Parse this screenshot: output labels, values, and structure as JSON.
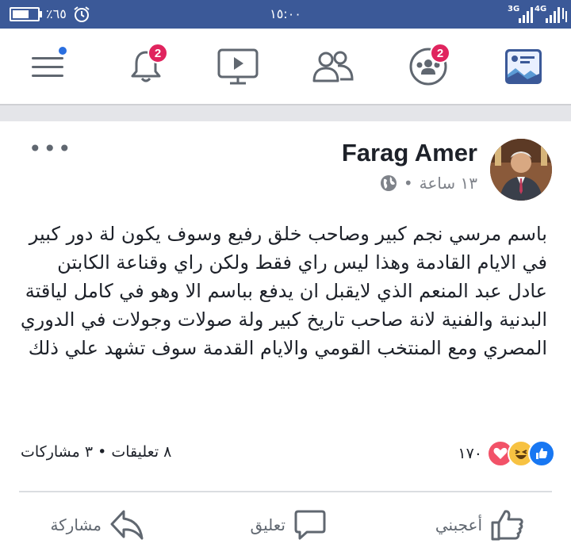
{
  "status_bar": {
    "battery_percent_text": "٪٦٥",
    "battery_level": 0.65,
    "time": "١٥:٠٠",
    "network_3g": "3G",
    "network_4g": "4G",
    "bg_color": "#3b5998"
  },
  "nav": {
    "items": [
      {
        "name": "menu",
        "icon": "hamburger-menu-icon",
        "has_dot": true
      },
      {
        "name": "notifications",
        "icon": "bell-icon",
        "badge": "2"
      },
      {
        "name": "watch",
        "icon": "video-play-icon"
      },
      {
        "name": "friends",
        "icon": "friends-icon"
      },
      {
        "name": "groups",
        "icon": "groups-icon",
        "badge": "2"
      },
      {
        "name": "news-feed",
        "icon": "news-feed-icon",
        "active": true
      }
    ],
    "accent_color": "#3b5998",
    "badge_color": "#e0245e"
  },
  "post": {
    "author": "Farag Amer",
    "time": "١٣ ساعة",
    "privacy_icon": "globe-icon",
    "more_label": "•••",
    "text": "باسم مرسي نجم كبير وصاحب خلق رفيع وسوف يكون لة دور كبير في الايام القادمة وهذا ليس راي فقط ولكن راي وقناعة الكابتن عادل عبد المنعم  الذي لايقبل ان يدفع بباسم الا وهو في كامل لياقتة البدنية والفنية لانة صاحب تاريخ كبير ولة صولات وجولات في الدوري المصري ومع المنتخب القومي والايام القدمة سوف تشهد علي ذلك",
    "reactions_count": "١٧٠",
    "reaction_icons": [
      "like-icon",
      "haha-icon",
      "love-icon"
    ],
    "stats": "٨ تعليقات • ٣ مشاركات",
    "actions": {
      "like": "أعجبني",
      "comment": "تعليق",
      "share": "مشاركة"
    }
  }
}
